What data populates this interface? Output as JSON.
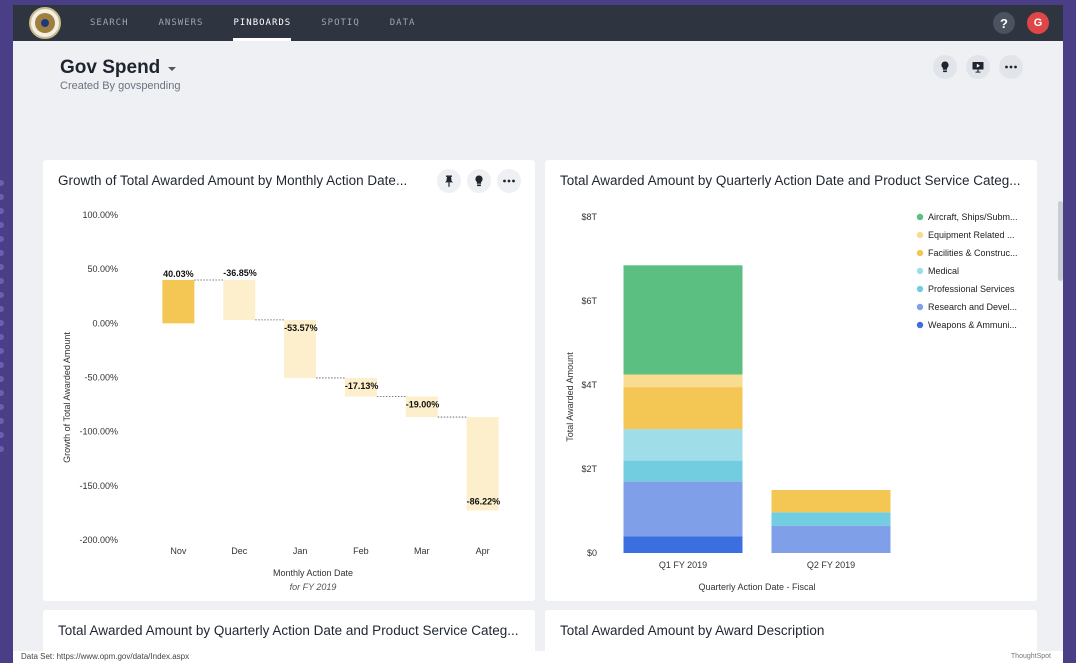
{
  "nav": {
    "items": [
      "SEARCH",
      "ANSWERS",
      "PINBOARDS",
      "SPOTIQ",
      "DATA"
    ],
    "active": "PINBOARDS",
    "help_label": "?",
    "avatar_initial": "G"
  },
  "pinboard": {
    "title": "Gov Spend",
    "subtitle": "Created By govspending"
  },
  "cards": {
    "c1_title": "Growth of Total Awarded Amount by Monthly Action Date...",
    "c2_title": "Total Awarded Amount by Quarterly Action Date and Product Service Categ...",
    "c3_title": "Total Awarded Amount by Quarterly Action Date and Product Service Categ...",
    "c4_title": "Total Awarded Amount by Award Description"
  },
  "footer": {
    "dataset": "Data Set: https://www.opm.gov/data/Index.aspx",
    "brand": "ThoughtSpot"
  },
  "colors": {
    "accent_bar": "#f4c754",
    "light_bar": "#fdefcb"
  },
  "chart_data": [
    {
      "type": "bar",
      "subtype": "waterfall",
      "ylabel": "Growth of Total Awarded Amount",
      "xlabel": "Monthly Action Date",
      "xsublabel": "for FY 2019",
      "ylim": [
        -200,
        100
      ],
      "yticks": [
        100,
        50,
        0,
        -50,
        -100,
        -150,
        -200
      ],
      "ytick_labels": [
        "100.00%",
        "50.00%",
        "0.00%",
        "-50.00%",
        "-100.00%",
        "-150.00%",
        "-200.00%"
      ],
      "categories": [
        "Nov",
        "Dec",
        "Jan",
        "Feb",
        "Mar",
        "Apr"
      ],
      "values": [
        40.03,
        -36.85,
        -53.57,
        -17.13,
        -19.0,
        -86.22
      ],
      "value_labels": [
        "40.03%",
        "-36.85%",
        "-53.57%",
        "-17.13%",
        "-19.00%",
        "-86.22%"
      ]
    },
    {
      "type": "bar",
      "subtype": "stacked",
      "ylabel": "Total Awarded Amount",
      "xlabel": "Quarterly Action Date - Fiscal",
      "ylim": [
        0,
        8
      ],
      "yticks": [
        0,
        2,
        4,
        6,
        8
      ],
      "ytick_labels": [
        "$0",
        "$2T",
        "$4T",
        "$6T",
        "$8T"
      ],
      "categories": [
        "Q1 FY 2019",
        "Q2 FY 2019"
      ],
      "legend_position": "top-right",
      "series": [
        {
          "name": "Weapons & Ammuni...",
          "color": "#3b6fe0",
          "values": [
            0.4,
            0.0
          ]
        },
        {
          "name": "Research and Devel...",
          "color": "#7f9fe8",
          "values": [
            1.3,
            0.65
          ]
        },
        {
          "name": "Professional Services",
          "color": "#72cde0",
          "values": [
            0.5,
            0.32
          ]
        },
        {
          "name": "Medical",
          "color": "#9fdde9",
          "values": [
            0.75,
            0.0
          ]
        },
        {
          "name": "Facilities & Construc...",
          "color": "#f4c754",
          "values": [
            1.0,
            0.53
          ]
        },
        {
          "name": "Equipment Related ...",
          "color": "#f8dc8f",
          "values": [
            0.3,
            0.0
          ]
        },
        {
          "name": "Aircraft, Ships/Subm...",
          "color": "#5bbf82",
          "values": [
            2.6,
            0.0
          ]
        }
      ],
      "legend_order": [
        "Aircraft, Ships/Subm...",
        "Equipment Related ...",
        "Facilities & Construc...",
        "Medical",
        "Professional Services",
        "Research and Devel...",
        "Weapons & Ammuni..."
      ]
    }
  ]
}
